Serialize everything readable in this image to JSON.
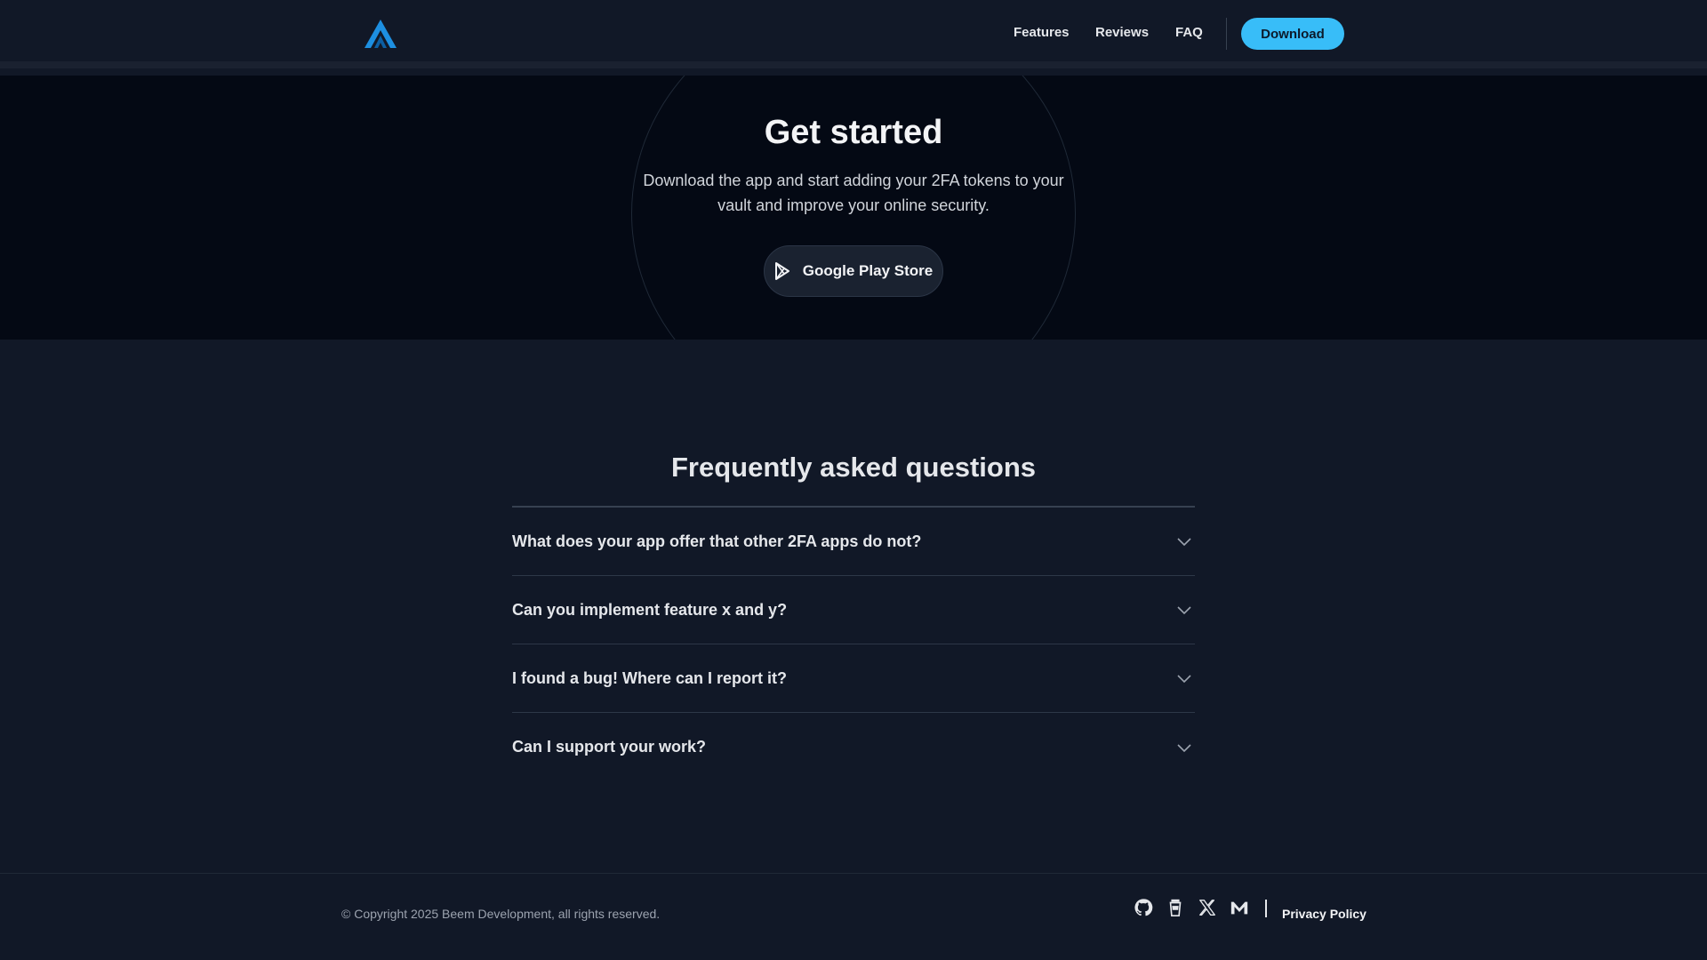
{
  "header": {
    "logo_icon": "app-logo-icon",
    "nav": [
      {
        "label": "Features"
      },
      {
        "label": "Reviews"
      },
      {
        "label": "FAQ"
      }
    ],
    "download_label": "Download",
    "accent_color": "#38bdf8"
  },
  "hero": {
    "title": "Get started",
    "description": "Download the app and start adding your 2FA tokens to your vault and improve your online security.",
    "store_button": {
      "label": "Google Play Store",
      "icon": "google-play-icon"
    }
  },
  "faq": {
    "title": "Frequently asked questions",
    "items": [
      {
        "question": "What does your app offer that other 2FA apps do not?"
      },
      {
        "question": "Can you implement feature x and y?"
      },
      {
        "question": "I found a bug! Where can I report it?"
      },
      {
        "question": "Can I support your work?"
      }
    ]
  },
  "footer": {
    "copyright": "© Copyright 2025 Beem Development, all rights reserved.",
    "social_icons": [
      "github-icon",
      "coffee-icon",
      "x-icon",
      "mail-icon"
    ],
    "privacy_label": "Privacy Policy"
  }
}
